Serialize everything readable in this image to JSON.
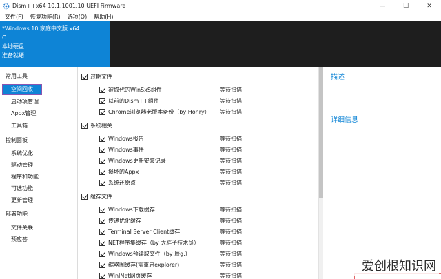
{
  "window": {
    "title": "Dism++x64 10.1.1001.10 UEFI Firmware",
    "controls": {
      "minimize": "—",
      "maximize": "☐",
      "close": "✕"
    }
  },
  "menu": [
    "文件(F)",
    "恢复功能(R)",
    "选项(O)",
    "帮助(H)"
  ],
  "system": {
    "os": "*Windows 10 家庭中文版 x64",
    "drive": "C:",
    "disk": "本地硬盘",
    "status": "准备就绪"
  },
  "sidebar": {
    "groups": [
      {
        "label": "常用工具",
        "items": [
          "空间回收",
          "启动项管理",
          "Appx管理",
          "工具箱"
        ]
      },
      {
        "label": "控制面板",
        "items": [
          "系统优化",
          "驱动管理",
          "程序和功能",
          "可选功能",
          "更新管理"
        ]
      },
      {
        "label": "部署功能",
        "items": [
          "文件关联",
          "预应答"
        ]
      }
    ],
    "selected": "空间回收"
  },
  "categories": [
    {
      "label": "过期文件",
      "items": [
        {
          "label": "被取代的WinSxS组件",
          "status": "等待扫描"
        },
        {
          "label": "以前的Dism++组件",
          "status": "等待扫描"
        },
        {
          "label": "Chrome浏览器老版本备份（by Honry）",
          "status": "等待扫描"
        }
      ]
    },
    {
      "label": "系统相关",
      "items": [
        {
          "label": "Windows报告",
          "status": "等待扫描"
        },
        {
          "label": "Windows事件",
          "status": "等待扫描"
        },
        {
          "label": "Windows更新安装记录",
          "status": "等待扫描"
        },
        {
          "label": "损坏的Appx",
          "status": "等待扫描"
        },
        {
          "label": "系统还原点",
          "status": "等待扫描"
        }
      ]
    },
    {
      "label": "缓存文件",
      "items": [
        {
          "label": "Windows下载缓存",
          "status": "等待扫描"
        },
        {
          "label": "传递优化缓存",
          "status": "等待扫描"
        },
        {
          "label": "Terminal Server Client缓存",
          "status": "等待扫描"
        },
        {
          "label": "NET程序集缓存（by 大胖子技术员）",
          "status": "等待扫描"
        },
        {
          "label": "Windows预读取文件（by 辰g.）",
          "status": "等待扫描"
        },
        {
          "label": "缩略图缓存(需重启explorer)",
          "status": "等待扫描"
        },
        {
          "label": "WinINet网页缓存",
          "status": "等待扫描"
        }
      ]
    }
  ],
  "right_panel": {
    "description_title": "描述",
    "details_title": "详细信息"
  },
  "watermark": "爱创根知识网",
  "colors": {
    "accent": "#0e84d6",
    "dark_panel": "#1e1e1e",
    "selection_outline": "#8a55b0"
  }
}
